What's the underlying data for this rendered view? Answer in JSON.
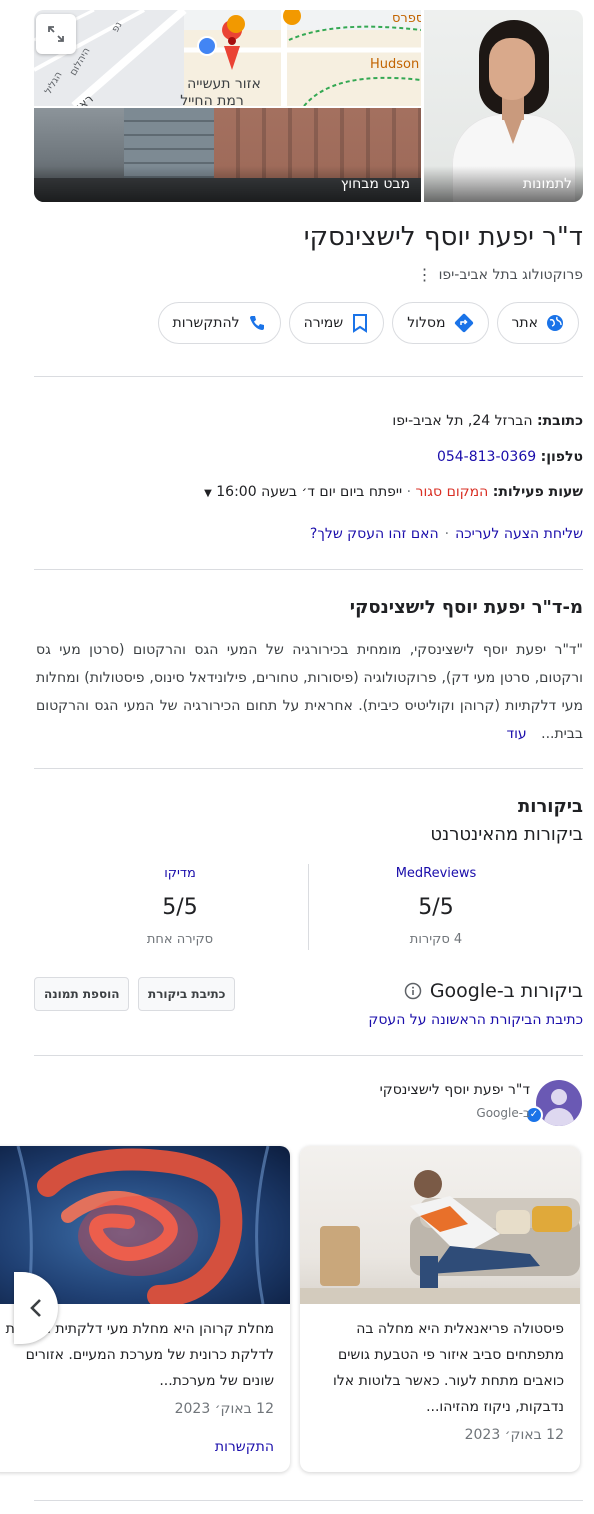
{
  "header": {
    "photos_label": "לתמונות",
    "street_view_label": "מבט מבחוץ",
    "map_labels": {
      "place1": "שגב אקספרס",
      "place2": "מסעדת הדסון | Hudson",
      "area1": "אזור תעשייה",
      "area2": "רמת החייל",
      "street1": "ראול ולנברג",
      "street2": "הגליל",
      "street3": "היהלום",
      "street4": "נפ"
    }
  },
  "business": {
    "name": "ד\"ר יפעת יוסף לישצינסקי",
    "category": "פרוקטולוג בתל אביב-יפו"
  },
  "actions": [
    {
      "label": "אתר",
      "icon": "globe-icon"
    },
    {
      "label": "מסלול",
      "icon": "directions-icon"
    },
    {
      "label": "שמירה",
      "icon": "bookmark-icon"
    },
    {
      "label": "להתקשרות",
      "icon": "phone-icon"
    }
  ],
  "info": {
    "address_label": "כתובת:",
    "address": "הברזל 24, תל אביב-יפו",
    "phone_label": "טלפון:",
    "phone": "054-813-0369",
    "hours_label": "שעות פעילות:",
    "hours_status": "המקום סגור",
    "hours_next": "ייפתח ביום יום ד׳ בשעה 16:00",
    "suggest_edit": "שליחת הצעה לעריכה",
    "own_business": "האם זהו העסק שלך?"
  },
  "about": {
    "title": "מ-ד\"ר יפעת יוסף לישצינסקי",
    "text": "\"ד\"ר יפעת יוסף לישצינסקי, מומחית בכירורגיה של המעי הגס והרקטום (סרטן מעי גס ורקטום, סרטן מעי דק), פרוקטולוגיה (פיסורות, טחורים, פילונידאל סינוס, פיסטולות) ומחלות מעי דלקתיות (קרוהן וקוליטיס כיבית). אחראית על תחום הכירורגיה של המעי הגס והרקטום בבית...",
    "more": "עוד"
  },
  "reviews": {
    "title": "ביקורות",
    "subtitle": "ביקורות מהאינטרנט",
    "sources": [
      {
        "name": "MedReviews",
        "score": "5/5",
        "count": "4 סקירות"
      },
      {
        "name": "מדיקו",
        "score": "5/5",
        "count": "סקירה אחת"
      }
    ],
    "google_title": "ביקורות ב-Google",
    "write_review": "כתיבת ביקורת",
    "add_photo": "הוספת תמונה",
    "first_review": "כתיבת הביקורת הראשונה על העסק"
  },
  "posts": {
    "author": "ד\"ר יפעת יוסף לישצינסקי",
    "author_sub": "ב-Google",
    "items": [
      {
        "text": "פיסטולה פריאנאלית היא מחלה בה מתפתחים סביב איזור פי הטבעת גושים כואבים מתחת לעור. כאשר בלוטות אלו נדבקות, ניקוז מהזיהו...",
        "date": "12 באוק׳ 2023"
      },
      {
        "text": "מחלת קרוהן היא מחלת מעי דלקתית הגורמת לדלקת כרונית של מערכת המעיים. אזורים שונים של מערכת...",
        "date": "12 באוק׳ 2023",
        "cta": "התקשרות"
      }
    ]
  }
}
